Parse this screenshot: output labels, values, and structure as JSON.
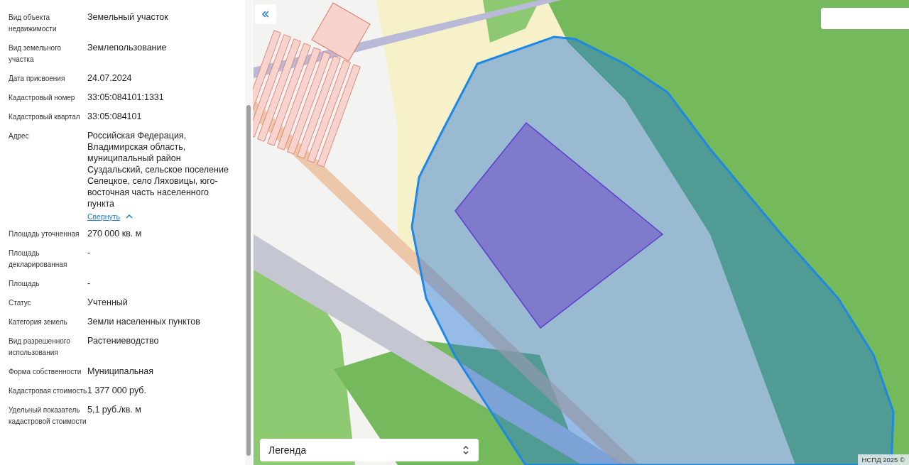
{
  "fields": [
    {
      "label": "Вид объекта недвижимости",
      "value": "Земельный участок"
    },
    {
      "label": "Вид земельного участка",
      "value": "Землепользование"
    },
    {
      "label": "Дата присвоения",
      "value": "24.07.2024"
    },
    {
      "label": "Кадастровый номер",
      "value": "33:05:084101:1331"
    },
    {
      "label": "Кадастровый квартал",
      "value": "33:05:084101"
    },
    {
      "label": "Адрес",
      "value": "Российская Федерация, Владимирская область, муниципальный район Суздальский, сельское поселение Селецкое, село Ляховицы, юго-восточная часть населенного пункта",
      "toggle": {
        "label": "Свернуть",
        "expanded": true
      }
    },
    {
      "label": "Площадь уточненная",
      "value": "270 000 кв. м"
    },
    {
      "label": "Площадь декларированная",
      "value": "-"
    },
    {
      "label": "Площадь",
      "value": "-"
    },
    {
      "label": "Статус",
      "value": "Учтенный"
    },
    {
      "label": "Категория земель",
      "value": "Земли населенных пунктов"
    },
    {
      "label": "Вид разрешенного использования",
      "value": "Растениеводство"
    },
    {
      "label": "Форма собственности",
      "value": "Муниципальная"
    },
    {
      "label": "Кадастровая стоимость",
      "value": "1 377 000 руб."
    },
    {
      "label": "Удельный показатель кадастровой стоимости",
      "value": "5,1 руб./кв. м"
    }
  ],
  "map": {
    "legend": {
      "label": "Легенда"
    },
    "attribution": "НСПД 2025 ©"
  }
}
